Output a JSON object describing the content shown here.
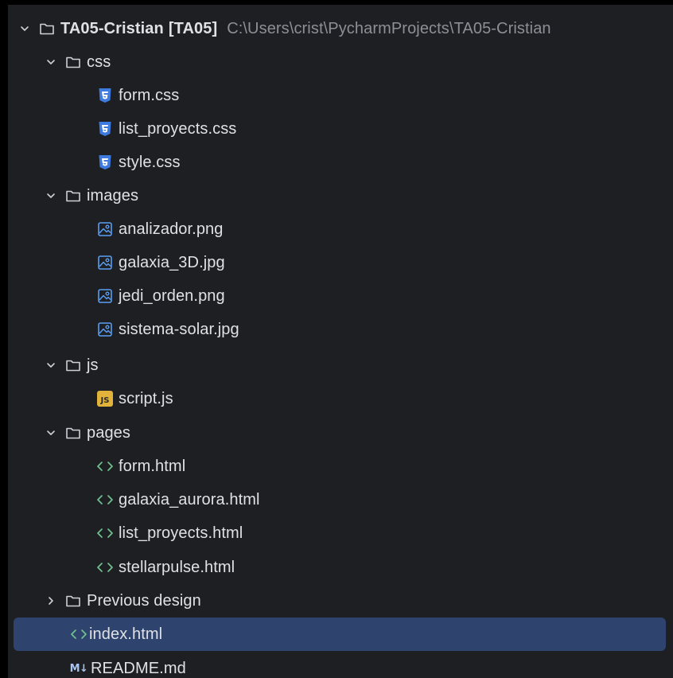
{
  "project": {
    "name": "TA05-Cristian",
    "module": "[TA05]",
    "path": "C:\\Users\\crist\\PycharmProjects\\TA05-Cristian"
  },
  "folders": {
    "css": "css",
    "images": "images",
    "js": "js",
    "pages": "pages",
    "previous": "Previous design"
  },
  "files": {
    "form_css": "form.css",
    "list_css": "list_proyects.css",
    "style_css": "style.css",
    "analizador": "analizador.png",
    "galaxia_3d": "galaxia_3D.jpg",
    "jedi_orden": "jedi_orden.png",
    "sistema_solar": "sistema-solar.jpg",
    "script_js": "script.js",
    "form_html": "form.html",
    "galaxia_aurora": "galaxia_aurora.html",
    "list_html": "list_proyects.html",
    "stellarpulse": "stellarpulse.html",
    "index_html": "index.html",
    "readme": "README.md"
  },
  "icons": {
    "folder": "folder-icon",
    "css": "css-file-icon",
    "image": "image-file-icon",
    "js": "js-file-icon",
    "html": "html-file-icon",
    "markdown": "markdown-file-icon",
    "js_badge_text": "JS",
    "md_badge_text": "M↓"
  },
  "colors": {
    "background": "#1e1f22",
    "selection": "#2e436e",
    "text": "#dfe1e5",
    "path_text": "#8c8f96",
    "css_icon": "#3d7be0",
    "image_icon": "#5a9df0",
    "js_icon": "#e2b33b",
    "html_icon": "#71c28f"
  }
}
